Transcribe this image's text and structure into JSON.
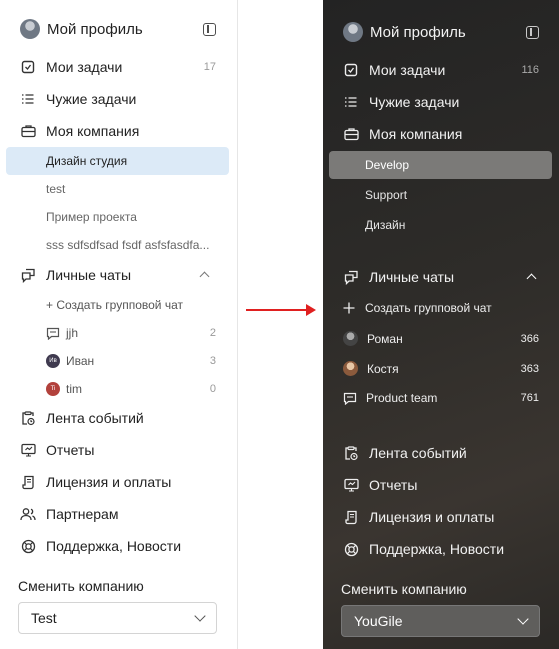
{
  "light": {
    "profile_title": "Мой профиль",
    "nav": {
      "my_tasks": "Мои задачи",
      "my_tasks_count": "17",
      "other_tasks": "Чужие задачи",
      "my_company": "Моя компания"
    },
    "projects": [
      "Дизайн студия",
      "test",
      "Пример проекта",
      "sss sdfsdfsad fsdf asfsfasdfa..."
    ],
    "chats": {
      "label": "Личные чаты",
      "create_group": "+ Создать групповой чат",
      "items": [
        {
          "name": "jjh",
          "count": "2",
          "avatar_color": "#ffffff"
        },
        {
          "name": "Иван",
          "count": "3",
          "avatar_color": "#3f3a4f",
          "initials": "Ив"
        },
        {
          "name": "tim",
          "count": "0",
          "avatar_color": "#b2413c",
          "initials": "Ti"
        }
      ]
    },
    "bottom_nav": {
      "events": "Лента событий",
      "reports": "Отчеты",
      "license": "Лицензия и оплаты",
      "partners": "Партнерам",
      "support": "Поддержка, Новости"
    },
    "switch_company_label": "Сменить компанию",
    "company_value": "Test"
  },
  "dark": {
    "profile_title": "Мой профиль",
    "nav": {
      "my_tasks": "Мои задачи",
      "my_tasks_count": "116",
      "other_tasks": "Чужие задачи",
      "my_company": "Моя компания"
    },
    "projects": [
      "Develop",
      "Support",
      "Дизайн"
    ],
    "chats": {
      "label": "Личные чаты",
      "create_group": "Создать групповой чат",
      "items": [
        {
          "name": "Роман",
          "count": "366"
        },
        {
          "name": "Костя",
          "count": "363"
        },
        {
          "name": "Product team",
          "count": "761"
        }
      ]
    },
    "bottom_nav": {
      "events": "Лента событий",
      "reports": "Отчеты",
      "license": "Лицензия и оплаты",
      "support": "Поддержка, Новости"
    },
    "switch_company_label": "Сменить компанию",
    "company_value": "YouGile"
  },
  "colors": {
    "selection_light": "#dceaf7",
    "selection_dark": "#7b7a78",
    "arrow": "#e02020"
  }
}
